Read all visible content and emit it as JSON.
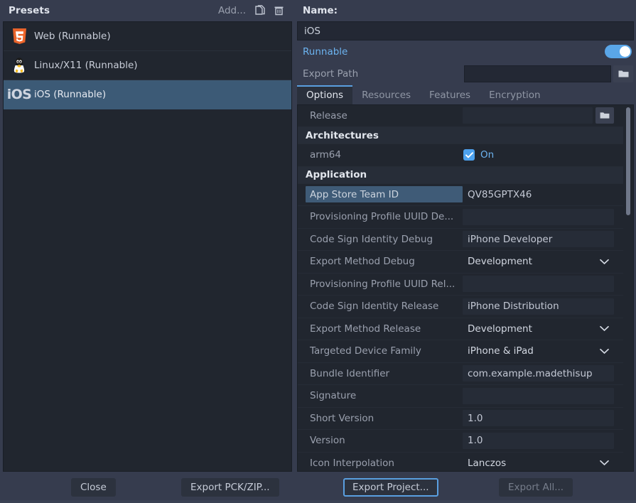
{
  "presets_panel": {
    "title": "Presets",
    "add_label": "Add...",
    "duplicate_icon": "duplicate-icon",
    "delete_icon": "trash-icon",
    "items": [
      {
        "icon": "html5-icon",
        "label": "Web (Runnable)",
        "selected": false
      },
      {
        "icon": "linux-tux-icon",
        "label": "Linux/X11 (Runnable)",
        "selected": false
      },
      {
        "icon": "ios-icon",
        "icon_text": "iOS",
        "label": "iOS (Runnable)",
        "selected": true
      }
    ]
  },
  "details_panel": {
    "name_label": "Name:",
    "name_value": "iOS",
    "runnable_label": "Runnable",
    "runnable_on": true,
    "export_path_label": "Export Path",
    "export_path_value": "",
    "tabs": [
      {
        "label": "Options",
        "active": true
      },
      {
        "label": "Resources",
        "active": false
      },
      {
        "label": "Features",
        "active": false
      },
      {
        "label": "Encryption",
        "active": false
      }
    ],
    "options": [
      {
        "kind": "folder",
        "name": "Release",
        "value": ""
      },
      {
        "kind": "section",
        "name": "Architectures"
      },
      {
        "kind": "checkbox",
        "name": "arm64",
        "value": "On",
        "checked": true
      },
      {
        "kind": "section",
        "name": "Application"
      },
      {
        "kind": "text",
        "name": "App Store Team ID",
        "value": "QV85GPTX46",
        "selected": true,
        "inset": false
      },
      {
        "kind": "text",
        "name": "Provisioning Profile UUID De...",
        "value": "",
        "inset": true
      },
      {
        "kind": "text",
        "name": "Code Sign Identity Debug",
        "value": "iPhone Developer",
        "inset": true
      },
      {
        "kind": "dropdown",
        "name": "Export Method Debug",
        "value": "Development"
      },
      {
        "kind": "text",
        "name": "Provisioning Profile UUID Rel...",
        "value": "",
        "inset": true
      },
      {
        "kind": "text",
        "name": "Code Sign Identity Release",
        "value": "iPhone Distribution",
        "inset": true
      },
      {
        "kind": "dropdown",
        "name": "Export Method Release",
        "value": "Development"
      },
      {
        "kind": "dropdown",
        "name": "Targeted Device Family",
        "value": "iPhone & iPad"
      },
      {
        "kind": "text",
        "name": "Bundle Identifier",
        "value": "com.example.madethisup",
        "inset": true
      },
      {
        "kind": "text",
        "name": "Signature",
        "value": "",
        "inset": true
      },
      {
        "kind": "text",
        "name": "Short Version",
        "value": "1.0",
        "inset": true
      },
      {
        "kind": "text",
        "name": "Version",
        "value": "1.0",
        "inset": true
      },
      {
        "kind": "dropdown",
        "name": "Icon Interpolation",
        "value": "Lanczos"
      }
    ],
    "scroll_thumb_percent": 30
  },
  "footer": {
    "close_label": "Close",
    "export_pck_zip_label": "Export PCK/ZIP...",
    "export_project_label": "Export Project...",
    "export_all_label": "Export All...",
    "export_all_disabled": true,
    "export_project_focused": true
  },
  "colors": {
    "window_bg": "#363c4e",
    "panel_bg": "#21262f",
    "accent_blue": "#5a9fe0",
    "selection_blue": "#3c5a76",
    "link_blue": "#6cb3f0",
    "text": "#c3c8d4",
    "muted_text": "#9aa0ae"
  }
}
